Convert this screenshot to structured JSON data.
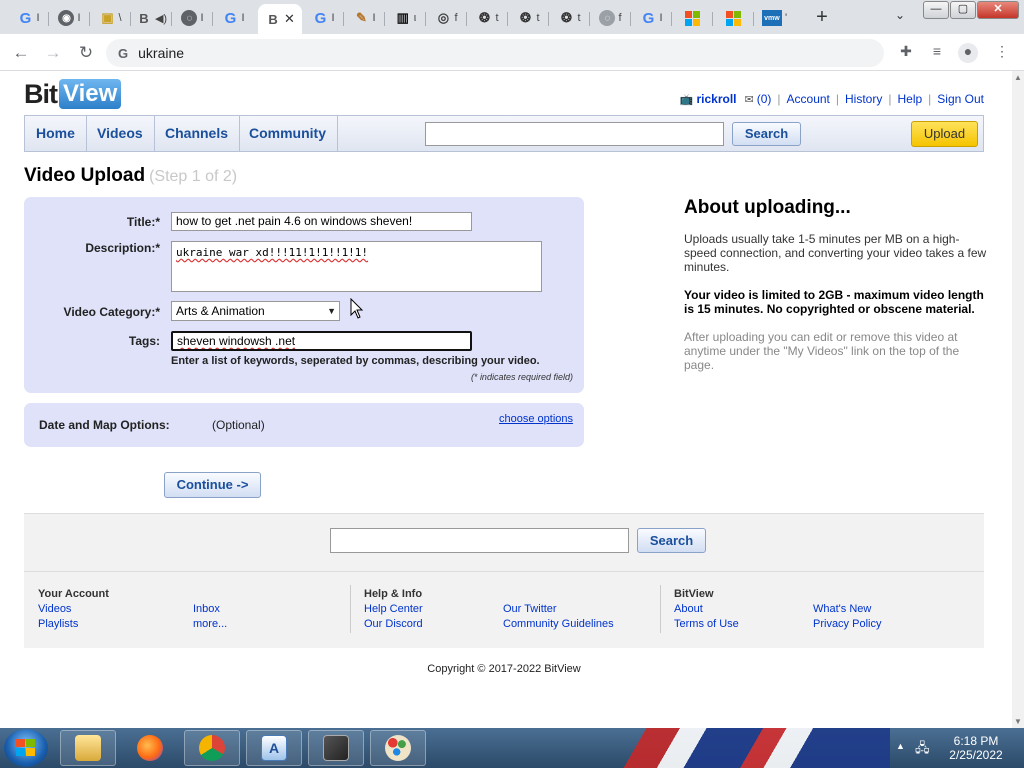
{
  "browser": {
    "tabs": [
      {
        "icon": "google-g-icon",
        "letter": "G",
        "title": "Ι"
      },
      {
        "icon": "github-icon",
        "letter": "◉",
        "title": "Ι"
      },
      {
        "icon": "folder-icon",
        "letter": "▣",
        "title": "\\"
      },
      {
        "icon": "bitview-b-icon",
        "letter": "B",
        "title": "◀)"
      },
      {
        "icon": "globe-icon",
        "letter": "◌",
        "title": "Ι"
      },
      {
        "icon": "google-g-icon",
        "letter": "G",
        "title": "Ι"
      },
      {
        "icon": "bitview-b-icon",
        "letter": "B",
        "title": "✕",
        "active": true
      },
      {
        "icon": "google-g-icon",
        "letter": "G",
        "title": "Ι"
      },
      {
        "icon": "bird-icon",
        "letter": "✎",
        "title": "Ι"
      },
      {
        "icon": "archive-icon",
        "letter": "▥",
        "title": "ι"
      },
      {
        "icon": "chrome-icon",
        "letter": "◎",
        "title": "f"
      },
      {
        "icon": "openai-icon",
        "letter": "❂",
        "title": "t"
      },
      {
        "icon": "openai-icon",
        "letter": "❂",
        "title": "t"
      },
      {
        "icon": "openai-icon",
        "letter": "❂",
        "title": "t"
      },
      {
        "icon": "globe-icon",
        "letter": "◌",
        "title": "f"
      },
      {
        "icon": "google-g-icon",
        "letter": "G",
        "title": "Ι"
      },
      {
        "icon": "microsoft-icon",
        "letter": "",
        "title": ""
      },
      {
        "icon": "microsoft-icon",
        "letter": "",
        "title": ""
      },
      {
        "icon": "vmware-icon",
        "letter": "vmw",
        "title": "'"
      }
    ],
    "new_tab": "+",
    "tab_search": "⌄",
    "window_controls": {
      "minimize": "—",
      "maximize": "▢",
      "close": "✕"
    },
    "address": "ukraine",
    "nav": {
      "back": "←",
      "forward": "→",
      "reload": "↻"
    }
  },
  "site": {
    "logo_bit": "Bit",
    "logo_view": "View",
    "user": {
      "username": "rickroll",
      "inbox_count": "(0)",
      "links": [
        "Account",
        "History",
        "Help",
        "Sign Out"
      ]
    },
    "nav_tabs": [
      "Home",
      "Videos",
      "Channels",
      "Community"
    ],
    "search_button": "Search",
    "upload_button": "Upload"
  },
  "upload": {
    "title": "Video Upload",
    "step": "(Step 1 of 2)",
    "fields": {
      "title_label": "Title:*",
      "title_value": "how to get .net pain 4.6 on windows sheven!",
      "description_label": "Description:*",
      "description_value": "ukraine war xd!!!11!1!1!!1!1!",
      "category_label": "Video Category:*",
      "category_value": "Arts & Animation",
      "tags_label": "Tags:",
      "tags_value": "sheven windowsh .net"
    },
    "tags_hint": "Enter a list of keywords, seperated by commas, describing your video.",
    "required_note": "(* indicates required field)",
    "date_map_label": "Date and Map Options:",
    "date_map_optional": "(Optional)",
    "choose_options": "choose options",
    "continue_button": "Continue ->"
  },
  "about": {
    "heading": "About uploading...",
    "p1": "Uploads usually take 1-5 minutes per MB on a high-speed connection, and converting your video takes a few minutes.",
    "p2": "Your video is limited to 2GB - maximum video length is 15 minutes. No copyrighted or obscene material.",
    "p3": "After uploading you can edit or remove this video at anytime under the \"My Videos\" link on the top of the page."
  },
  "footer": {
    "search_button": "Search",
    "your_account": {
      "heading": "Your Account",
      "links": [
        "Videos",
        "Playlists",
        "Inbox",
        "more..."
      ]
    },
    "help_info": {
      "heading": "Help & Info",
      "links": [
        "Help Center",
        "Our Discord",
        "Our Twitter",
        "Community Guidelines"
      ]
    },
    "bitview": {
      "heading": "BitView",
      "links": [
        "About",
        "Terms of Use",
        "What's New",
        "Privacy Policy"
      ]
    },
    "copyright": "Copyright © 2017-2022 BitView"
  },
  "taskbar": {
    "apps": [
      "file-explorer",
      "firefox",
      "chrome",
      "wordpad",
      "game",
      "paint"
    ],
    "time": "6:18 PM",
    "date": "2/25/2022"
  },
  "colors": {
    "link": "#0033cc",
    "nav_text": "#1a4f9c",
    "form_bg": "#dfe2f9",
    "upload_yellow": "#f5c400"
  }
}
